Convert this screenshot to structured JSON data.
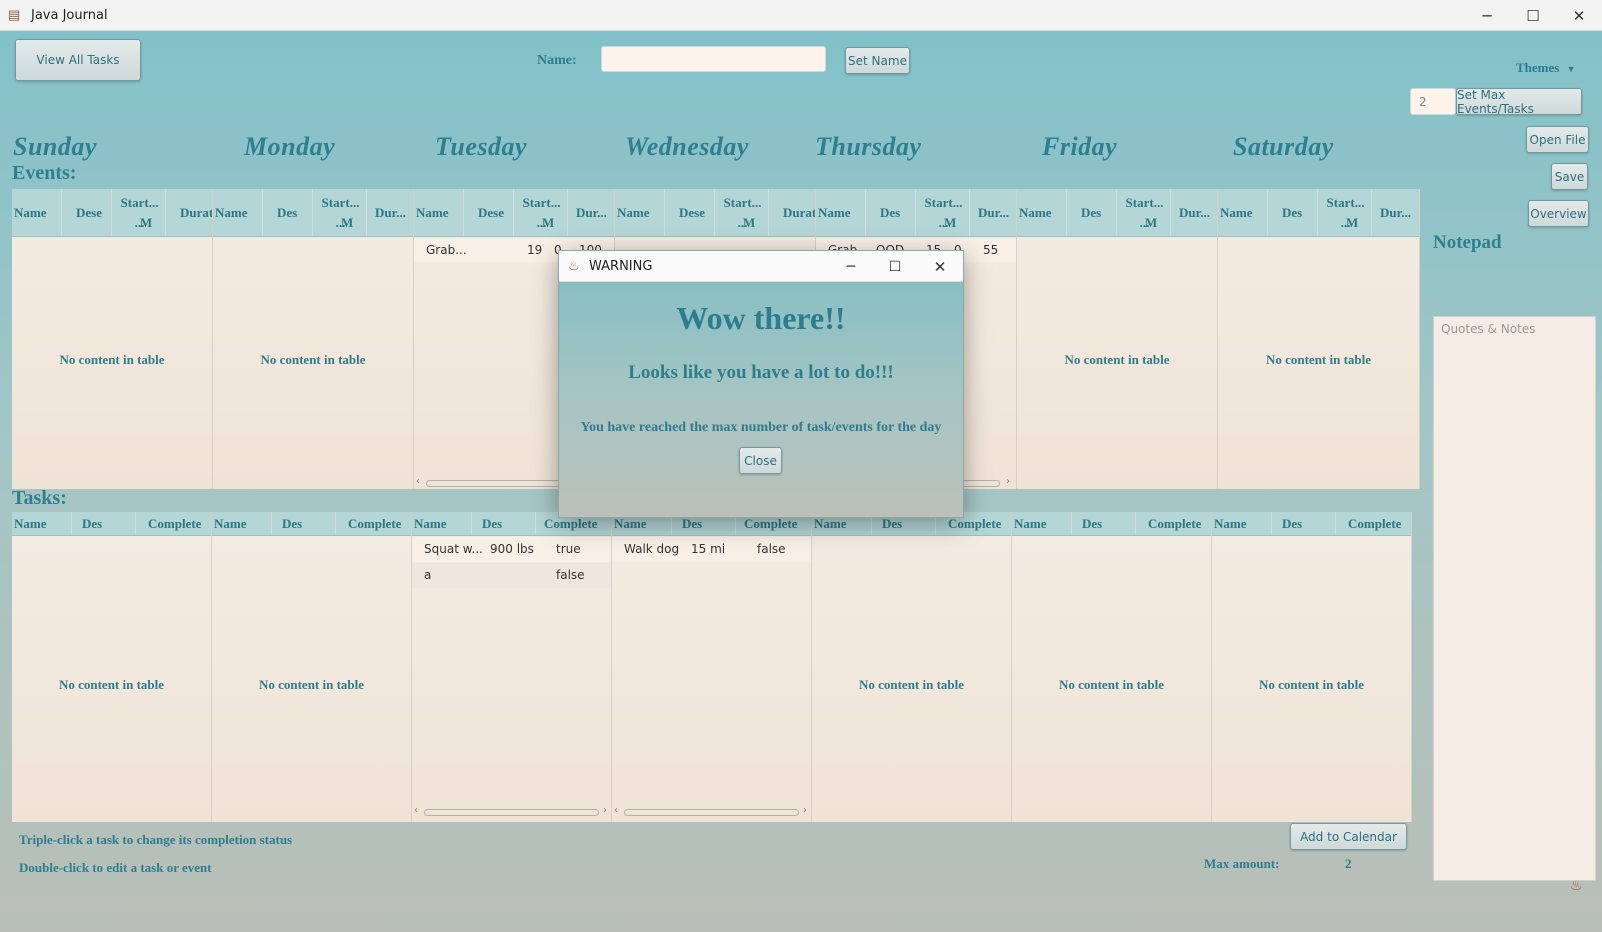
{
  "window": {
    "title": "Java Journal",
    "min": "─",
    "max": "☐",
    "close": "✕"
  },
  "top": {
    "view_all_tasks": "View All Tasks",
    "name_label": "Name:",
    "name_value": "",
    "set_name": "Set Name",
    "themes": "Themes",
    "max_value": "2",
    "set_max": "Set Max Events/Tasks",
    "open_file": "Open File",
    "save": "Save",
    "overview": "Overview"
  },
  "days": [
    "Sunday",
    "Monday",
    "Tuesday",
    "Wednesday",
    "Thursday",
    "Friday",
    "Saturday"
  ],
  "events_label": "Events:",
  "tasks_label": "Tasks:",
  "event_headers": {
    "name": "Name",
    "dese": "Dese",
    "des": "Des",
    "start": "Start...",
    "start2": "...",
    "m": "M",
    "duration": "Duratio",
    "dur": "Dur..."
  },
  "task_headers": {
    "name": "Name",
    "des": "Des",
    "complete": "Complete"
  },
  "empty_text": "No content in table",
  "events": {
    "tuesday": [
      {
        "name": "Grab...",
        "start": "19",
        "m": "0",
        "dur": "100"
      }
    ],
    "thursday": [
      {
        "name": "Grab",
        "des": "OOD",
        "start": "15",
        "m": "0",
        "dur": "55"
      }
    ]
  },
  "tasks": {
    "tuesday": [
      {
        "name": "Squat w...",
        "des": "900 lbs",
        "complete": "true"
      },
      {
        "name": "a",
        "des": "",
        "complete": "false"
      }
    ],
    "wednesday": [
      {
        "name": "Walk dog",
        "des": "15 mi",
        "complete": "false"
      }
    ]
  },
  "notepad": {
    "title": "Notepad",
    "placeholder": "Quotes & Notes"
  },
  "hints": {
    "triple": "Triple-click a task to change its completion status",
    "double": "Double-click to edit a task or event"
  },
  "add_to_calendar": "Add to Calendar",
  "max_amount_label": "Max amount:",
  "max_amount_value": "2",
  "dialog": {
    "title": "WARNING",
    "heading": "Wow there!!",
    "sub": "Looks like you have a lot to do!!!",
    "message": "You have reached the max number of task/events for the day",
    "close": "Close"
  },
  "colors": {
    "accent": "#2e7d8e",
    "background_top": "#82c1c9",
    "table_bg": "#f4ece3"
  }
}
